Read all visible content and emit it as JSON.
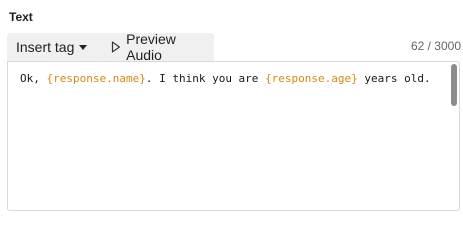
{
  "field": {
    "label": "Text"
  },
  "toolbar": {
    "insert_tag_label": "Insert tag",
    "preview_audio_label": "Preview Audio"
  },
  "counter": {
    "text": "62 / 3000"
  },
  "editor": {
    "segments": {
      "s0": "Ok, ",
      "s1": "{response.name}",
      "s2": ". I think you are ",
      "s3": "{response.age}",
      "s4": " years old."
    }
  },
  "colors": {
    "tag": "#d48a14",
    "toolbar_bg": "#f0f0f0",
    "border": "#d9d9d9"
  },
  "icons": {
    "insert_tag": "chevron-down-icon",
    "preview_audio": "play-icon"
  }
}
